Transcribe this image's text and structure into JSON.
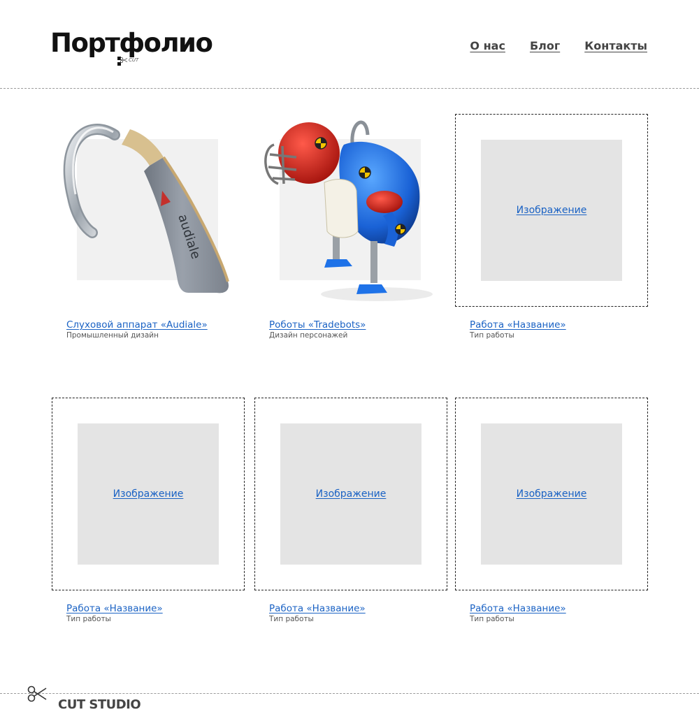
{
  "header": {
    "title": "Портфолио",
    "cut_mark": "CUT",
    "nav": [
      {
        "label": "О нас"
      },
      {
        "label": "Блог"
      },
      {
        "label": "Контакты"
      }
    ]
  },
  "works": [
    {
      "title": "Слуховой аппарат «Audiale»",
      "type": "Промышленный дизайн",
      "image": "hearing-aid",
      "image_text": "audiale"
    },
    {
      "title": "Роботы «Tradebots»",
      "type": "Дизайн персонажей",
      "image": "robot"
    },
    {
      "title": "Работа «Название»",
      "type": "Тип работы",
      "placeholder": "Изображение"
    },
    {
      "title": "Работа «Название»",
      "type": "Тип работы",
      "placeholder": "Изображение"
    },
    {
      "title": "Работа «Название»",
      "type": "Тип работы",
      "placeholder": "Изображение"
    },
    {
      "title": "Работа «Название»",
      "type": "Тип работы",
      "placeholder": "Изображение"
    }
  ],
  "footer": {
    "brand": "CUT STUDIO",
    "icon": "scissors-icon"
  },
  "colors": {
    "link": "#1a62c4",
    "placeholder_bg": "#e4e4e4",
    "divider": "#9a9a9a"
  }
}
